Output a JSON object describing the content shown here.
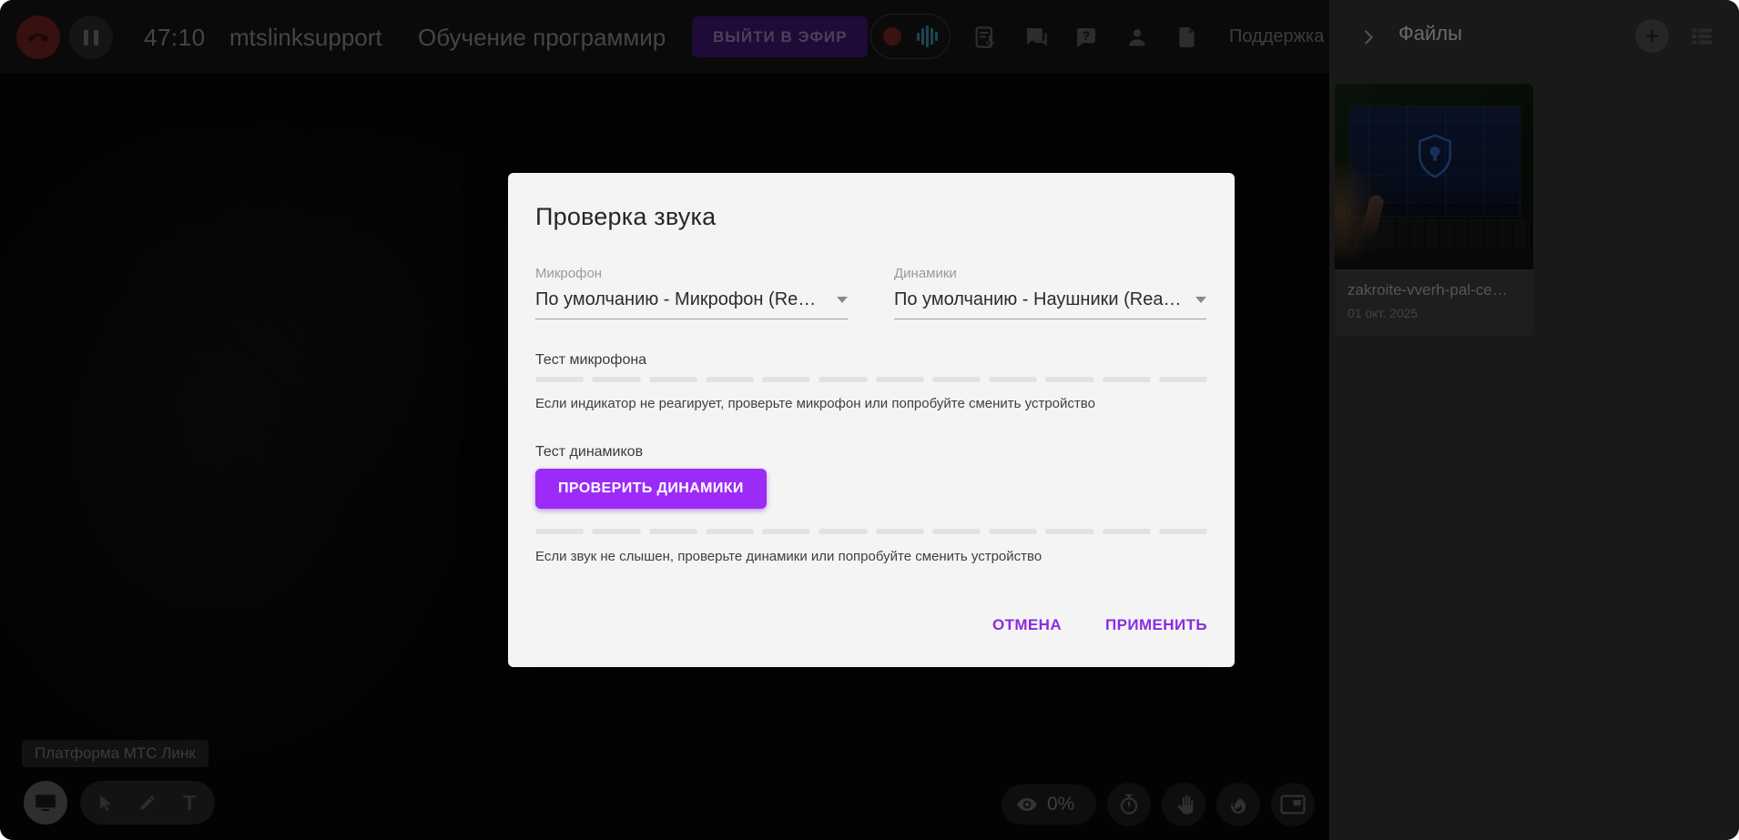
{
  "topbar": {
    "timer": "47:10",
    "username": "mtslinksupport",
    "event_title": "Обучение программир",
    "go_live_label": "ВЫЙТИ В ЭФИР",
    "support_label": "Поддержка"
  },
  "stage": {
    "watermark": "Платформа МТС Линк",
    "attention_percent": "0%"
  },
  "sidebar": {
    "title": "Файлы",
    "file": {
      "name": "zakroite-vverh-pal-ce…",
      "date": "01 окт. 2025"
    }
  },
  "dialog": {
    "title": "Проверка звука",
    "microphone": {
      "label": "Микрофон",
      "value": "По умолчанию - Микрофон (Re…"
    },
    "speakers": {
      "label": "Динамики",
      "value": "По умолчанию - Наушники (Rea…"
    },
    "mic_test": {
      "label": "Тест микрофона",
      "segments": 12,
      "hint": "Если индикатор не реагирует, проверьте микрофон или попробуйте сменить устройство"
    },
    "speaker_test": {
      "label": "Тест динамиков",
      "button_label": "ПРОВЕРИТЬ ДИНАМИКИ",
      "segments": 12,
      "hint": "Если звук не слышен, проверьте динамики или попробуйте сменить устройство"
    },
    "cancel_label": "ОТМЕНА",
    "apply_label": "ПРИМЕНИТЬ"
  },
  "colors": {
    "accent_purple": "#9c2bf7",
    "action_purple": "#8b2be2",
    "dialog_bg": "#f4f4f4",
    "sidebar_bg": "#191919",
    "record_red": "#3a1210"
  }
}
